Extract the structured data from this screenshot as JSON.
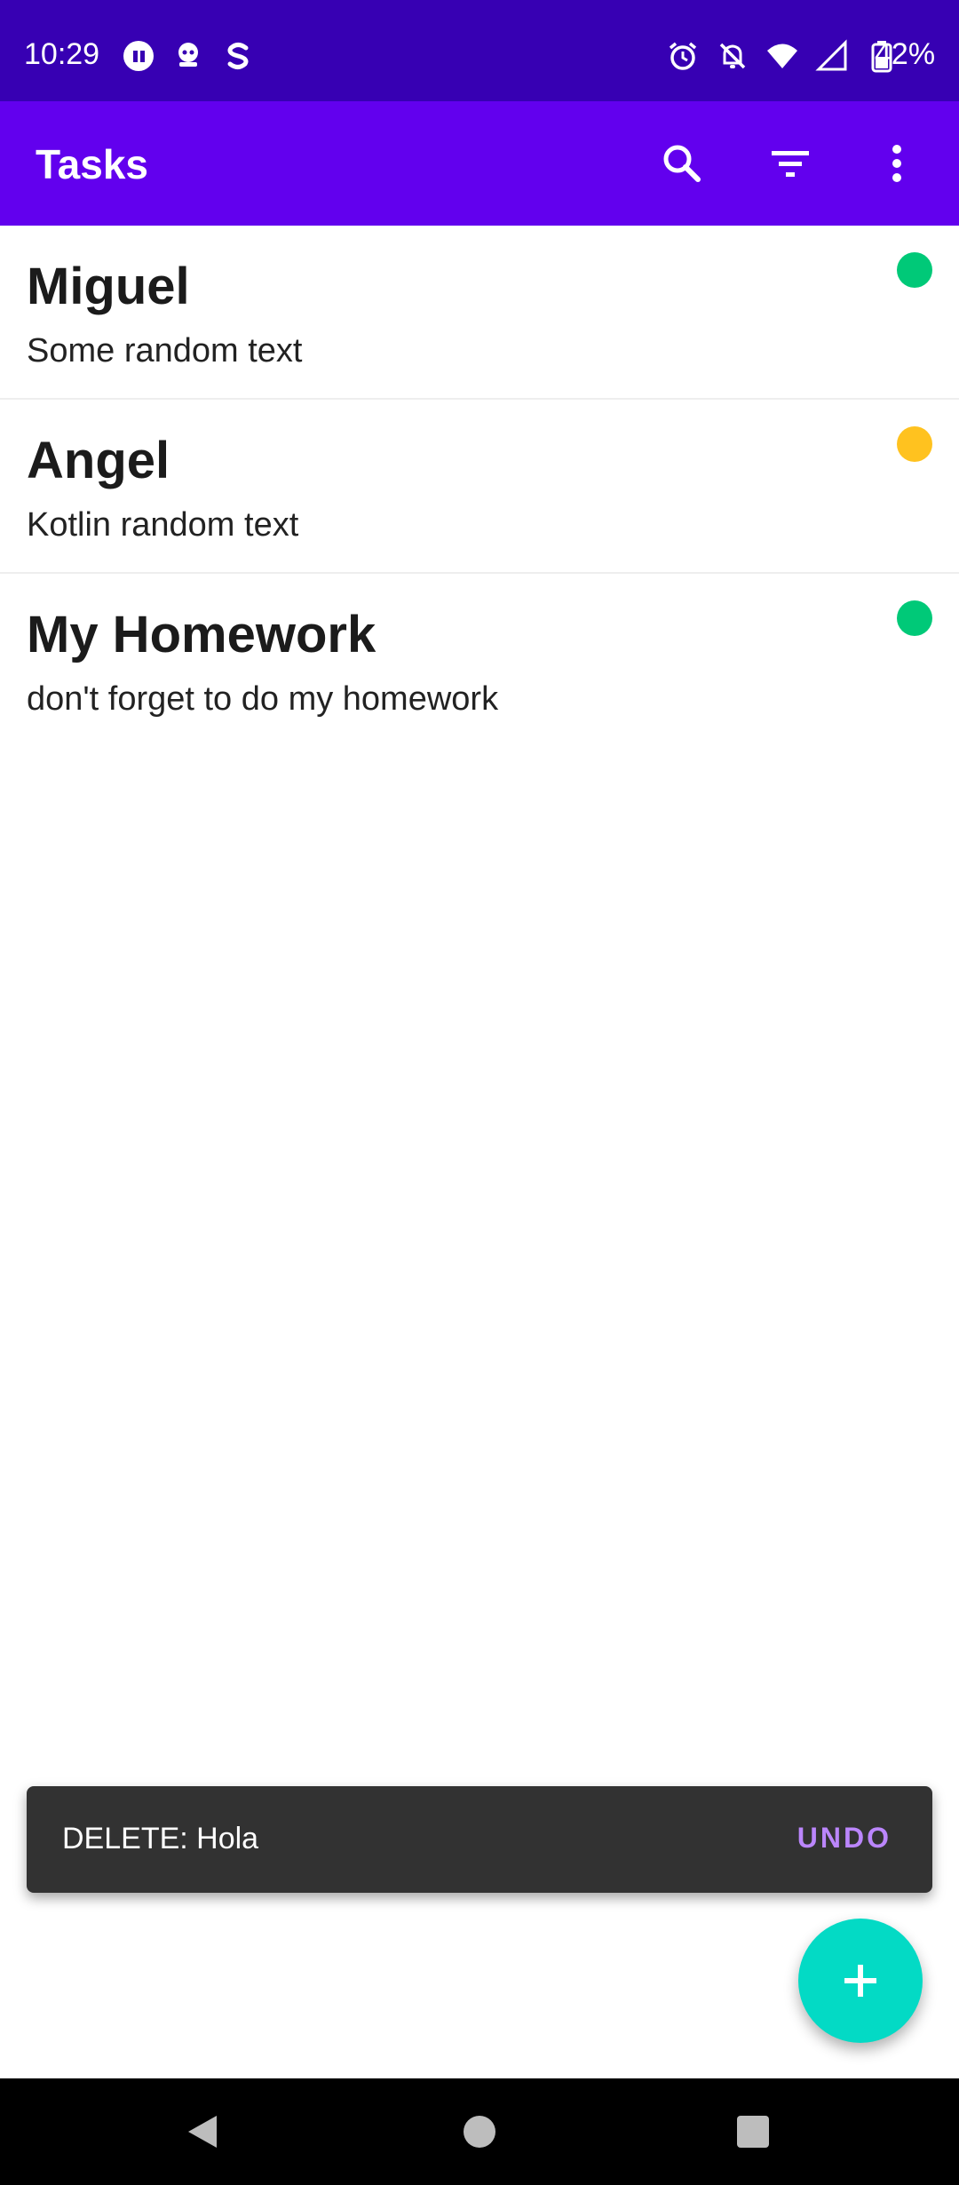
{
  "status_bar": {
    "time": "10:29",
    "battery_percent": "42%",
    "left_icons": [
      "vpn-key-icon",
      "notification-app-icon",
      "s-app-icon"
    ],
    "right_icons": [
      "alarm-icon",
      "notifications-off-icon",
      "wifi-icon",
      "cell-signal-icon",
      "battery-icon"
    ]
  },
  "app_bar": {
    "title": "Tasks",
    "actions": [
      "search-icon",
      "filter-icon",
      "more-vert-icon"
    ]
  },
  "tasks": [
    {
      "title": "Miguel",
      "description": "Some random text",
      "priority_color": "#00c978"
    },
    {
      "title": "Angel",
      "description": "Kotlin random text",
      "priority_color": "#ffc21f"
    },
    {
      "title": "My Homework",
      "description": "don't forget to do my homework",
      "priority_color": "#00c978"
    }
  ],
  "snackbar": {
    "message": "DELETE: Hola",
    "action_label": "UNDO"
  },
  "fab": {
    "icon": "add-icon",
    "color": "#03dac5"
  },
  "colors": {
    "status_bar": "#3700b3",
    "app_bar": "#6200ee",
    "accent": "#bb86fc"
  },
  "nav_bar": {
    "buttons": [
      "back-icon",
      "home-icon",
      "recents-icon"
    ]
  }
}
